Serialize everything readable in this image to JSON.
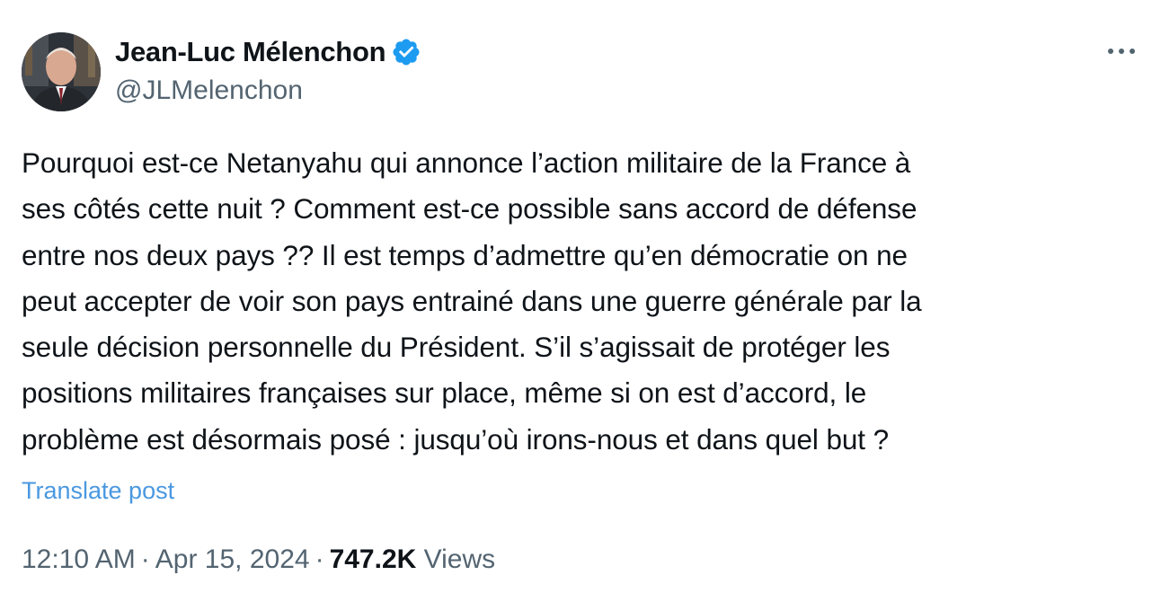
{
  "author": {
    "display_name": "Jean-Luc Mélenchon",
    "handle": "@JLMelenchon",
    "verified": true,
    "badge_color": "#1d9bf0"
  },
  "icons": {
    "verified": "verified-badge-icon",
    "more": "more-options-icon",
    "avatar": "profile-photo"
  },
  "tweet": {
    "text": "Pourquoi est-ce Netanyahu qui annonce l’action militaire de la France à\nses côtés cette nuit ? Comment est-ce possible sans accord de défense\nentre nos deux pays ?? Il est temps d’admettre qu’en démocratie on ne\npeut accepter de voir son pays entrainé dans une guerre générale par la\nseule décision personnelle du Président. S’il s’agissait de protéger les\npositions militaires françaises sur place, même si on est d’accord, le\nproblème est désormais posé : jusqu’où irons-nous et dans quel but ?",
    "translate_label": "Translate post"
  },
  "meta": {
    "time": "12:10 AM",
    "separator": "·",
    "date": "Apr 15, 2024",
    "views_count": "747.2K",
    "views_label": "Views"
  },
  "colors": {
    "text_primary": "#0f1419",
    "text_secondary": "#536471",
    "link": "#4a98e0"
  }
}
